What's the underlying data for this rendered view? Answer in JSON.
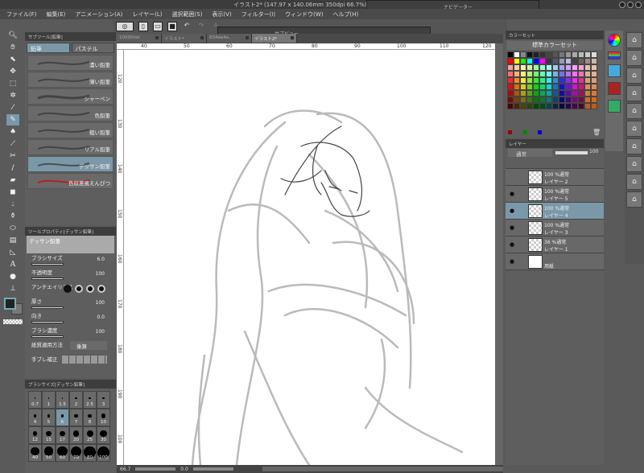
{
  "window": {
    "title": "イラスト2* (147.97 x 140.06mm 350dpi 66.7%) - CLIP STUDIO PAINT"
  },
  "navigator": {
    "title": "ナビゲーター"
  },
  "subview": {
    "title": "サブビュー"
  },
  "menu": [
    "ファイル(F)",
    "編集(E)",
    "アニメーション(A)",
    "レイヤー(L)",
    "選択範囲(S)",
    "表示(V)",
    "フィルター(I)",
    "ウィンドウ(W)",
    "ヘルプ(H)"
  ],
  "canvas_tabs": [
    "10000twi",
    "イラスト*",
    "834ee4e...",
    "イラスト2*"
  ],
  "ruler_top": [
    "40",
    "50",
    "60",
    "70",
    "80",
    "90",
    "100",
    "110",
    "120"
  ],
  "ruler_left": [
    "120",
    "130",
    "140",
    "150",
    "160",
    "170",
    "180",
    "190",
    "100"
  ],
  "subtool": {
    "title": "サブツール[鉛筆]",
    "tabs": [
      "鉛筆",
      "パステル"
    ],
    "brushes": [
      "濃い鉛筆",
      "薄い鉛筆",
      "シャーペン",
      "色鉛筆",
      "粗い鉛筆",
      "リアル鉛筆",
      "デッサン鉛筆",
      "色収差風えんぴつ"
    ],
    "selected": 6
  },
  "toolprop": {
    "title": "ツールプロパティ[デッサン鉛筆]",
    "preview_name": "デッサン鉛筆",
    "rows": [
      {
        "label": "ブラシサイズ",
        "value": "6.0"
      },
      {
        "label": "不透明度",
        "value": "100"
      },
      {
        "label": "アンチエイリアス",
        "value": ""
      },
      {
        "label": "厚さ",
        "value": "100"
      },
      {
        "label": "向き",
        "value": "0.0"
      },
      {
        "label": "ブラシ濃度",
        "value": "100"
      }
    ],
    "paper_label": "紙質適用方法",
    "paper_value": "乗算",
    "stabilizer_label": "手ブレ補正"
  },
  "brushsize": {
    "title": "ブラシサイズ[デッサン鉛筆]",
    "sizes": [
      "0.7",
      "1",
      "1.5",
      "2",
      "2.5",
      "3",
      "4",
      "5",
      "6",
      "7",
      "8",
      "10",
      "12",
      "15",
      "17",
      "20",
      "25",
      "30",
      "40",
      "50",
      "60",
      "70",
      "80",
      "100"
    ],
    "selected": "6"
  },
  "colorset": {
    "title": "カラーセット",
    "set_name": "標準カラーセット"
  },
  "layer": {
    "title": "レイヤー",
    "blend": "通常",
    "opacity": "100",
    "layers": [
      {
        "mode": "100 %通常",
        "name": "レイヤー 2",
        "visible": false,
        "selected": false
      },
      {
        "mode": "100 %通常",
        "name": "レイヤー 5",
        "visible": true,
        "selected": false
      },
      {
        "mode": "100 %通常",
        "name": "レイヤー 4",
        "visible": true,
        "selected": true
      },
      {
        "mode": "100 %通常",
        "name": "レイヤー 3",
        "visible": true,
        "selected": false
      },
      {
        "mode": "36 %通常",
        "name": "レイヤー 1",
        "visible": true,
        "selected": false
      },
      {
        "mode": "",
        "name": "用紙",
        "visible": true,
        "selected": false
      }
    ]
  },
  "status": {
    "zoom": "66.7",
    "angle": "0.0"
  }
}
